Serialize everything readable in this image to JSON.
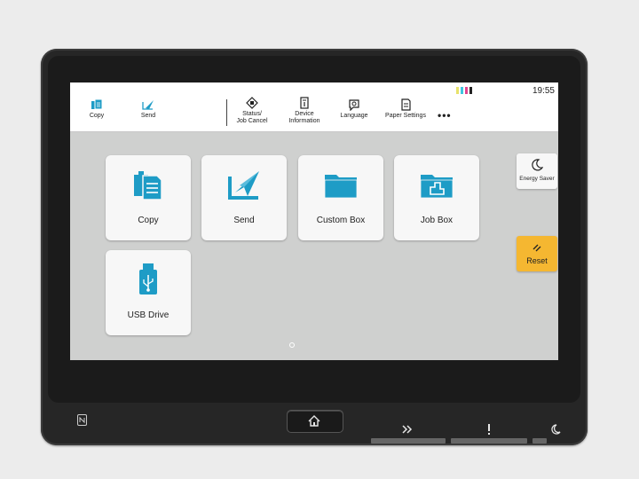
{
  "toolbar": {
    "copy_label": "Copy",
    "send_label": "Send",
    "status_label": "Status/\nJob Cancel",
    "device_info_label": "Device\nInformation",
    "language_label": "Language",
    "paper_settings_label": "Paper Settings",
    "more_label": "•••"
  },
  "status": {
    "time": "19:55",
    "toner_colors": [
      "#e8e26a",
      "#3ec4e0",
      "#e0448e",
      "#222222"
    ]
  },
  "tiles": [
    {
      "label": "Copy"
    },
    {
      "label": "Send"
    },
    {
      "label": "Custom Box"
    },
    {
      "label": "Job Box"
    },
    {
      "label": "USB Drive"
    }
  ],
  "side": {
    "energy_saver_label": "Energy Saver",
    "reset_label": "Reset"
  },
  "colors": {
    "accent": "#1e9cc6",
    "reset": "#f5b731",
    "bezel": "#262626"
  },
  "icons": [
    "copy-icon",
    "send-icon",
    "status-icon",
    "device-info-icon",
    "language-icon",
    "paper-settings-icon",
    "moon-icon",
    "reset-icon",
    "home-icon",
    "nfc-icon",
    "processing-icon",
    "attention-icon",
    "energy-saver-hw-icon"
  ]
}
